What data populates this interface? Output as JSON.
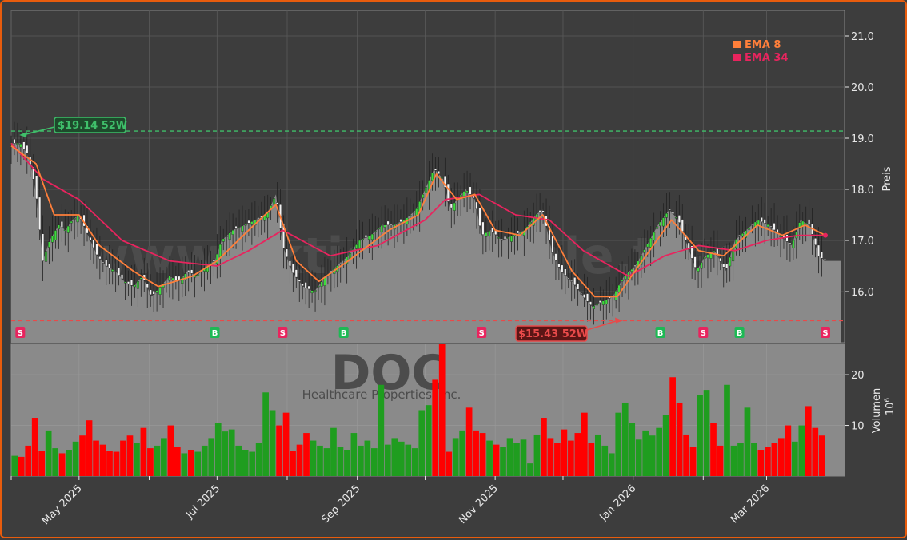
{
  "watermark": {
    "site": "www.aktiensignale.trade",
    "ticker": "DOC",
    "company": "Healthcare Properties, Inc."
  },
  "legend": [
    {
      "label": "EMA 8",
      "color": "#ff7f3a"
    },
    {
      "label": "EMA 34",
      "color": "#e8245e"
    }
  ],
  "price_axis": {
    "label": "Preis",
    "ylim": [
      15.0,
      21.5
    ],
    "ticks": [
      "16.0",
      "17.0",
      "18.0",
      "19.0",
      "20.0",
      "21.0"
    ]
  },
  "volume_axis": {
    "label": "Volumen",
    "unit": "10^6",
    "unit_base": "10",
    "unit_exp": "6",
    "ylim": [
      0,
      26
    ],
    "ticks": [
      "10",
      "20"
    ]
  },
  "date_ticks": [
    "May 2025",
    "Jul 2025",
    "Sep 2025",
    "Nov 2025",
    "Jan 2026",
    "Mar 2026"
  ],
  "annotations": {
    "high": {
      "label": "$19.14 52W",
      "value": 19.14,
      "color": "#3fbf6a"
    },
    "low": {
      "label": "$15.43 52W",
      "value": 15.43,
      "color": "#e84a4a"
    }
  },
  "colors": {
    "up": "#1f9d1f",
    "down": "#ff0000",
    "area": "#8a8a8a",
    "buy": "#1db954",
    "sell": "#e8245e"
  },
  "chart_data": {
    "type": "line",
    "title": "",
    "xlabel": "",
    "ylabel": "Preis",
    "x_range": [
      "2025-04-01",
      "2026-03-27"
    ],
    "close": [
      [
        "2025-04-01",
        18.9
      ],
      [
        "2025-04-05",
        18.9
      ],
      [
        "2025-04-08",
        18.7
      ],
      [
        "2025-04-10",
        18.4
      ],
      [
        "2025-04-12",
        17.9
      ],
      [
        "2025-04-15",
        16.6
      ],
      [
        "2025-04-18",
        17.0
      ],
      [
        "2025-04-22",
        17.3
      ],
      [
        "2025-04-25",
        17.2
      ],
      [
        "2025-04-28",
        17.4
      ],
      [
        "2025-05-01",
        17.5
      ],
      [
        "2025-05-05",
        17.1
      ],
      [
        "2025-05-09",
        16.7
      ],
      [
        "2025-05-13",
        16.5
      ],
      [
        "2025-05-17",
        16.4
      ],
      [
        "2025-05-21",
        16.2
      ],
      [
        "2025-05-25",
        16.1
      ],
      [
        "2025-05-29",
        16.3
      ],
      [
        "2025-06-02",
        15.9
      ],
      [
        "2025-06-06",
        16.1
      ],
      [
        "2025-06-10",
        16.3
      ],
      [
        "2025-06-14",
        16.2
      ],
      [
        "2025-06-18",
        16.4
      ],
      [
        "2025-06-22",
        16.3
      ],
      [
        "2025-06-26",
        16.5
      ],
      [
        "2025-06-30",
        16.6
      ],
      [
        "2025-07-03",
        17.0
      ],
      [
        "2025-07-08",
        17.2
      ],
      [
        "2025-07-13",
        17.3
      ],
      [
        "2025-07-18",
        17.4
      ],
      [
        "2025-07-23",
        17.5
      ],
      [
        "2025-07-27",
        17.9
      ],
      [
        "2025-07-30",
        16.9
      ],
      [
        "2025-08-03",
        16.4
      ],
      [
        "2025-08-08",
        16.1
      ],
      [
        "2025-08-13",
        16.0
      ],
      [
        "2025-08-18",
        16.3
      ],
      [
        "2025-08-23",
        16.5
      ],
      [
        "2025-08-28",
        16.7
      ],
      [
        "2025-09-02",
        17.0
      ],
      [
        "2025-09-07",
        17.1
      ],
      [
        "2025-09-12",
        17.3
      ],
      [
        "2025-09-17",
        17.3
      ],
      [
        "2025-09-22",
        17.4
      ],
      [
        "2025-09-27",
        17.6
      ],
      [
        "2025-10-01",
        18.0
      ],
      [
        "2025-10-05",
        18.4
      ],
      [
        "2025-10-09",
        18.2
      ],
      [
        "2025-10-12",
        17.6
      ],
      [
        "2025-10-15",
        17.8
      ],
      [
        "2025-10-19",
        18.0
      ],
      [
        "2025-10-23",
        17.8
      ],
      [
        "2025-10-26",
        17.1
      ],
      [
        "2025-10-30",
        17.2
      ],
      [
        "2025-11-04",
        17.0
      ],
      [
        "2025-11-09",
        17.1
      ],
      [
        "2025-11-14",
        17.2
      ],
      [
        "2025-11-19",
        17.5
      ],
      [
        "2025-11-22",
        17.6
      ],
      [
        "2025-11-26",
        16.8
      ],
      [
        "2025-11-30",
        16.4
      ],
      [
        "2025-12-05",
        16.2
      ],
      [
        "2025-12-10",
        15.9
      ],
      [
        "2025-12-14",
        15.7
      ],
      [
        "2025-12-18",
        15.8
      ],
      [
        "2025-12-23",
        15.9
      ],
      [
        "2025-12-28",
        16.3
      ],
      [
        "2026-01-02",
        16.5
      ],
      [
        "2026-01-07",
        16.9
      ],
      [
        "2026-01-12",
        17.3
      ],
      [
        "2026-01-17",
        17.6
      ],
      [
        "2026-01-21",
        17.4
      ],
      [
        "2026-01-25",
        16.9
      ],
      [
        "2026-01-29",
        16.4
      ],
      [
        "2026-02-02",
        16.7
      ],
      [
        "2026-02-06",
        16.8
      ],
      [
        "2026-02-11",
        16.4
      ],
      [
        "2026-02-15",
        17.0
      ],
      [
        "2026-02-20",
        17.2
      ],
      [
        "2026-02-25",
        17.4
      ],
      [
        "2026-03-02",
        17.3
      ],
      [
        "2026-03-07",
        17.1
      ],
      [
        "2026-03-12",
        16.9
      ],
      [
        "2026-03-16",
        17.4
      ],
      [
        "2026-03-20",
        17.3
      ],
      [
        "2026-03-24",
        16.7
      ],
      [
        "2026-03-27",
        16.6
      ]
    ],
    "ema8": [
      [
        "2025-04-01",
        18.85
      ],
      [
        "2025-04-12",
        18.5
      ],
      [
        "2025-04-20",
        17.5
      ],
      [
        "2025-05-01",
        17.5
      ],
      [
        "2025-05-10",
        16.9
      ],
      [
        "2025-05-25",
        16.4
      ],
      [
        "2025-06-05",
        16.1
      ],
      [
        "2025-06-20",
        16.3
      ],
      [
        "2025-07-01",
        16.6
      ],
      [
        "2025-07-15",
        17.2
      ],
      [
        "2025-07-27",
        17.7
      ],
      [
        "2025-08-05",
        16.6
      ],
      [
        "2025-08-15",
        16.2
      ],
      [
        "2025-08-28",
        16.6
      ],
      [
        "2025-09-15",
        17.2
      ],
      [
        "2025-09-28",
        17.5
      ],
      [
        "2025-10-06",
        18.3
      ],
      [
        "2025-10-15",
        17.8
      ],
      [
        "2025-10-23",
        17.9
      ],
      [
        "2025-11-01",
        17.2
      ],
      [
        "2025-11-12",
        17.1
      ],
      [
        "2025-11-22",
        17.5
      ],
      [
        "2025-12-05",
        16.4
      ],
      [
        "2025-12-15",
        15.9
      ],
      [
        "2025-12-25",
        15.9
      ],
      [
        "2026-01-05",
        16.6
      ],
      [
        "2026-01-18",
        17.4
      ],
      [
        "2026-01-30",
        16.8
      ],
      [
        "2026-02-10",
        16.7
      ],
      [
        "2026-02-25",
        17.3
      ],
      [
        "2026-03-08",
        17.1
      ],
      [
        "2026-03-18",
        17.3
      ],
      [
        "2026-03-27",
        17.1
      ]
    ],
    "ema34": [
      [
        "2025-04-01",
        18.9
      ],
      [
        "2025-04-15",
        18.2
      ],
      [
        "2025-05-01",
        17.8
      ],
      [
        "2025-05-20",
        17.0
      ],
      [
        "2025-06-10",
        16.6
      ],
      [
        "2025-07-01",
        16.5
      ],
      [
        "2025-07-15",
        16.8
      ],
      [
        "2025-07-30",
        17.2
      ],
      [
        "2025-08-20",
        16.7
      ],
      [
        "2025-09-10",
        16.9
      ],
      [
        "2025-10-01",
        17.4
      ],
      [
        "2025-10-10",
        17.8
      ],
      [
        "2025-10-25",
        17.9
      ],
      [
        "2025-11-10",
        17.5
      ],
      [
        "2025-11-25",
        17.4
      ],
      [
        "2025-12-10",
        16.8
      ],
      [
        "2025-12-30",
        16.3
      ],
      [
        "2026-01-15",
        16.7
      ],
      [
        "2026-01-30",
        16.9
      ],
      [
        "2026-02-15",
        16.8
      ],
      [
        "2026-03-01",
        17.0
      ],
      [
        "2026-03-15",
        17.1
      ],
      [
        "2026-03-27",
        17.1
      ]
    ],
    "signals": [
      {
        "type": "S",
        "date": "2025-04-05"
      },
      {
        "type": "B",
        "date": "2025-06-30"
      },
      {
        "type": "S",
        "date": "2025-07-30"
      },
      {
        "type": "B",
        "date": "2025-08-26"
      },
      {
        "type": "S",
        "date": "2025-10-26"
      },
      {
        "type": "B",
        "date": "2025-11-23"
      },
      {
        "type": "S",
        "date": "2025-11-26"
      },
      {
        "type": "B",
        "date": "2026-01-13"
      },
      {
        "type": "S",
        "date": "2026-02-01"
      },
      {
        "type": "B",
        "date": "2026-02-17"
      },
      {
        "type": "S",
        "date": "2026-03-27"
      }
    ],
    "volume_pattern": [
      4,
      3.8,
      6,
      11.5,
      5,
      9,
      5.5,
      4.5,
      5.2,
      6.8,
      8,
      11,
      7,
      6.2,
      5,
      4.8,
      7,
      8,
      6.5,
      9.5,
      5.5,
      6,
      7.5,
      10,
      5.8,
      4.5,
      5.2,
      4.8,
      6,
      7.5,
      10.5,
      8.8,
      9.2,
      6,
      5.2,
      4.8,
      6.5,
      16.5,
      13,
      10,
      12.5,
      5,
      6.2,
      8.5,
      7,
      6,
      5.5,
      9.5,
      5.8,
      5.2,
      8.5,
      6,
      7,
      5.5,
      18,
      6.2,
      7.5,
      6.8,
      6.2,
      5.5,
      13,
      14,
      19,
      26,
      4.8,
      7.5,
      9,
      13.5,
      9,
      8.5,
      7,
      6.2,
      5.8,
      7.5,
      6.5,
      7.2,
      2.5,
      8.2,
      11.5,
      7.5,
      6.5,
      9.2,
      7,
      8.5,
      12.5,
      6.5,
      8.2,
      6,
      4.5,
      12.5,
      14.5,
      10.5,
      7.2,
      9,
      8,
      9.5,
      12,
      19.5,
      14.5,
      8.2,
      5.8,
      16,
      17,
      10.5,
      6,
      18,
      6,
      6.5,
      13.5,
      6.5,
      5.2,
      5.8,
      6.5,
      7.5,
      10,
      6.8,
      10,
      13.8,
      9.5,
      8
    ]
  }
}
